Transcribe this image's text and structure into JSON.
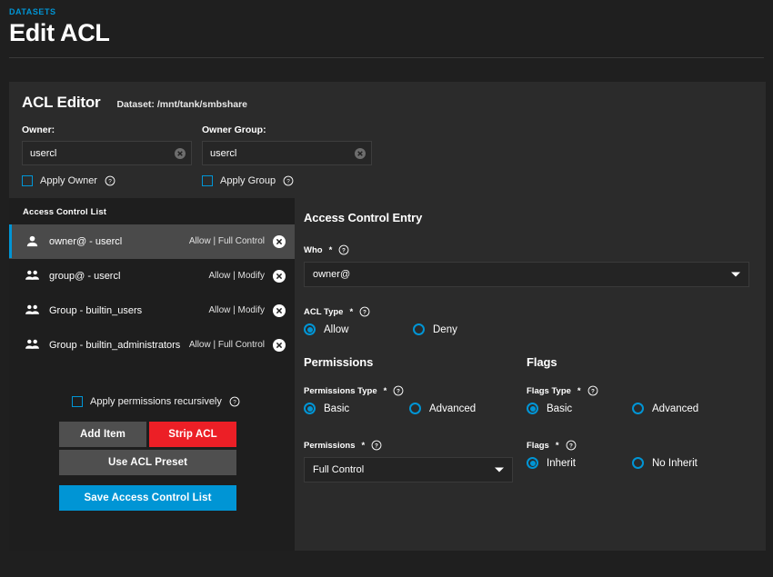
{
  "header": {
    "breadcrumb": "DATASETS",
    "title": "Edit ACL"
  },
  "editor": {
    "title": "ACL Editor",
    "dataset_label": "Dataset:",
    "dataset_path": "/mnt/tank/smbshare",
    "owner": {
      "label": "Owner:",
      "value": "usercl",
      "checkbox_label": "Apply Owner",
      "checked": false
    },
    "owner_group": {
      "label": "Owner Group:",
      "value": "usercl",
      "checkbox_label": "Apply Group",
      "checked": false
    }
  },
  "acl_list": {
    "header": "Access Control List",
    "rows": [
      {
        "icon": "user-icon",
        "who": "owner@ - usercl",
        "permission": "Allow | Full Control",
        "selected": true
      },
      {
        "icon": "group-icon",
        "who": "group@ - usercl",
        "permission": "Allow | Modify",
        "selected": false
      },
      {
        "icon": "group-icon",
        "who": "Group - builtin_users",
        "permission": "Allow | Modify",
        "selected": false
      },
      {
        "icon": "group-icon",
        "who": "Group - builtin_administrators",
        "permission": "Allow | Full Control",
        "selected": false
      }
    ]
  },
  "left_actions": {
    "recursive_label": "Apply permissions recursively",
    "recursive_checked": false,
    "add_item": "Add Item",
    "strip_acl": "Strip ACL",
    "use_preset": "Use ACL Preset",
    "save": "Save Access Control List"
  },
  "ace": {
    "title": "Access Control Entry",
    "who": {
      "label": "Who",
      "required": "*",
      "value": "owner@"
    },
    "acl_type": {
      "label": "ACL Type",
      "required": "*",
      "options": [
        {
          "label": "Allow",
          "selected": true
        },
        {
          "label": "Deny",
          "selected": false
        }
      ]
    }
  },
  "permissions": {
    "title": "Permissions",
    "type": {
      "label": "Permissions Type",
      "required": "*",
      "options": [
        {
          "label": "Basic",
          "selected": true
        },
        {
          "label": "Advanced",
          "selected": false
        }
      ]
    },
    "value": {
      "label": "Permissions",
      "required": "*",
      "selected": "Full Control"
    }
  },
  "flags": {
    "title": "Flags",
    "type": {
      "label": "Flags Type",
      "required": "*",
      "options": [
        {
          "label": "Basic",
          "selected": true
        },
        {
          "label": "Advanced",
          "selected": false
        }
      ]
    },
    "value": {
      "label": "Flags",
      "required": "*",
      "options": [
        {
          "label": "Inherit",
          "selected": true
        },
        {
          "label": "No Inherit",
          "selected": false
        }
      ]
    }
  },
  "colors": {
    "accent": "#0095d5",
    "danger": "#ec1f26",
    "panel": "#2b2b2b",
    "left_panel": "#1e1e1e",
    "page_bg": "#1f1f1f"
  }
}
